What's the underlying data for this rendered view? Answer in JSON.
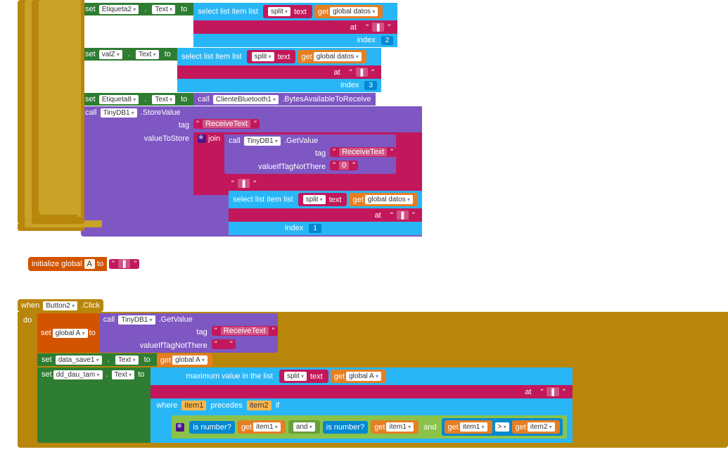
{
  "top": {
    "set1": {
      "set": "set",
      "comp": "Etiqueta2",
      "prop": "Text",
      "to": "to"
    },
    "set2": {
      "set": "set",
      "comp": "valZ",
      "prop": "Text",
      "to": "to"
    },
    "set3": {
      "set": "set",
      "comp": "Etiqueta8",
      "prop": "Text",
      "to": "to"
    },
    "selectList": "select list item  list",
    "index": "index",
    "idx2": "2",
    "idx3": "3",
    "idx1": "1",
    "split": "split",
    "textLbl": "text",
    "get": "get",
    "globalDatos": "global datos",
    "at": "at",
    "pipe": "❚",
    "call": "call",
    "clienteBT": "ClienteBluetooth1",
    "bytesAvail": ".BytesAvailableToReceive",
    "tinyDB": "TinyDB1",
    "storeValue": ".StoreValue",
    "tag": "tag",
    "valueToStore": "valueToStore",
    "receiveText": "ReceiveText",
    "join": "join",
    "getValue": ".GetValue",
    "valueIfTagNotThere": "valueIfTagNotThere",
    "zero": "0"
  },
  "init": {
    "label": "initialize global",
    "var": "A",
    "to": "to",
    "emptyPipe": "❚"
  },
  "btn": {
    "when": "when",
    "button2": "Button2",
    "click": ".Click",
    "do": "do",
    "set": "set",
    "globalA": "global A",
    "to": "to",
    "call": "call",
    "tinyDB": "TinyDB1",
    "getValue": ".GetValue",
    "tag": "tag",
    "receiveText": "ReceiveText",
    "valueIfTagNotThere": "valueIfTagNotThere",
    "empty": " ",
    "dataSave": "data_save1",
    "text": "Text",
    "get": "get",
    "ddDauTam": "dd_dau_tam",
    "maxVal": "maximum value in the list",
    "split": "split",
    "textLbl": "text",
    "at": "at",
    "pipe": "❚",
    "where": "where",
    "item1": "item1",
    "precedes": "precedes",
    "item2": "item2",
    "if": "if",
    "isNumber": "is number?",
    "and": "and",
    "gt": ">"
  }
}
